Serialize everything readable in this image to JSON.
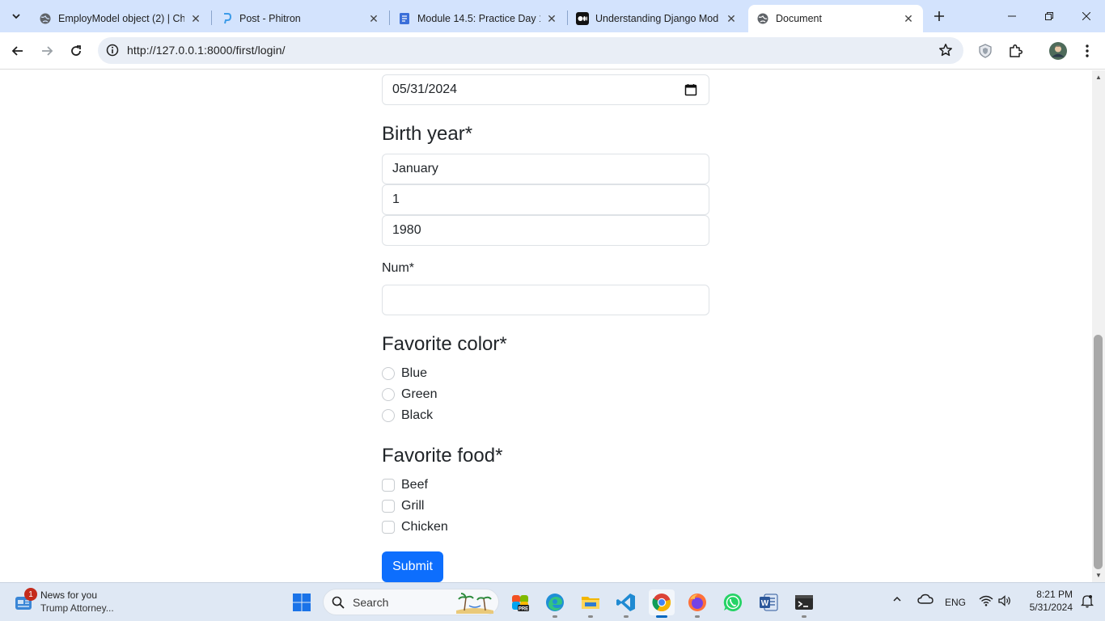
{
  "browser": {
    "tabs": [
      {
        "title": "EmployModel object (2) | Ch",
        "icon": "globe-icon"
      },
      {
        "title": "Post - Phitron",
        "icon": "phitron-icon"
      },
      {
        "title": "Module 14.5: Practice Day 1",
        "icon": "docs-icon"
      },
      {
        "title": "Understanding Django Mod",
        "icon": "medium-icon"
      },
      {
        "title": "Document",
        "icon": "globe-icon"
      }
    ],
    "url": "http://127.0.0.1:8000/first/login/"
  },
  "form": {
    "date_value": "05/31/2024",
    "birth_year": {
      "label": "Birth year*",
      "month": "January",
      "day": "1",
      "year": "1980"
    },
    "num": {
      "label": "Num*",
      "value": ""
    },
    "favorite_color": {
      "label": "Favorite color*",
      "options": [
        "Blue",
        "Green",
        "Black"
      ]
    },
    "favorite_food": {
      "label": "Favorite food*",
      "options": [
        "Beef",
        "Grill",
        "Chicken"
      ]
    },
    "submit_label": "Submit"
  },
  "taskbar": {
    "news": {
      "title": "News for you",
      "subtitle": "Trump Attorney...",
      "badge": "1"
    },
    "search_label": "Search",
    "language": "ENG",
    "time": "8:21 PM",
    "date": "5/31/2024"
  },
  "colors": {
    "tabstrip": "#d3e3fd",
    "primary_button": "#0d6efd",
    "taskbar": "#dfe8f4"
  }
}
